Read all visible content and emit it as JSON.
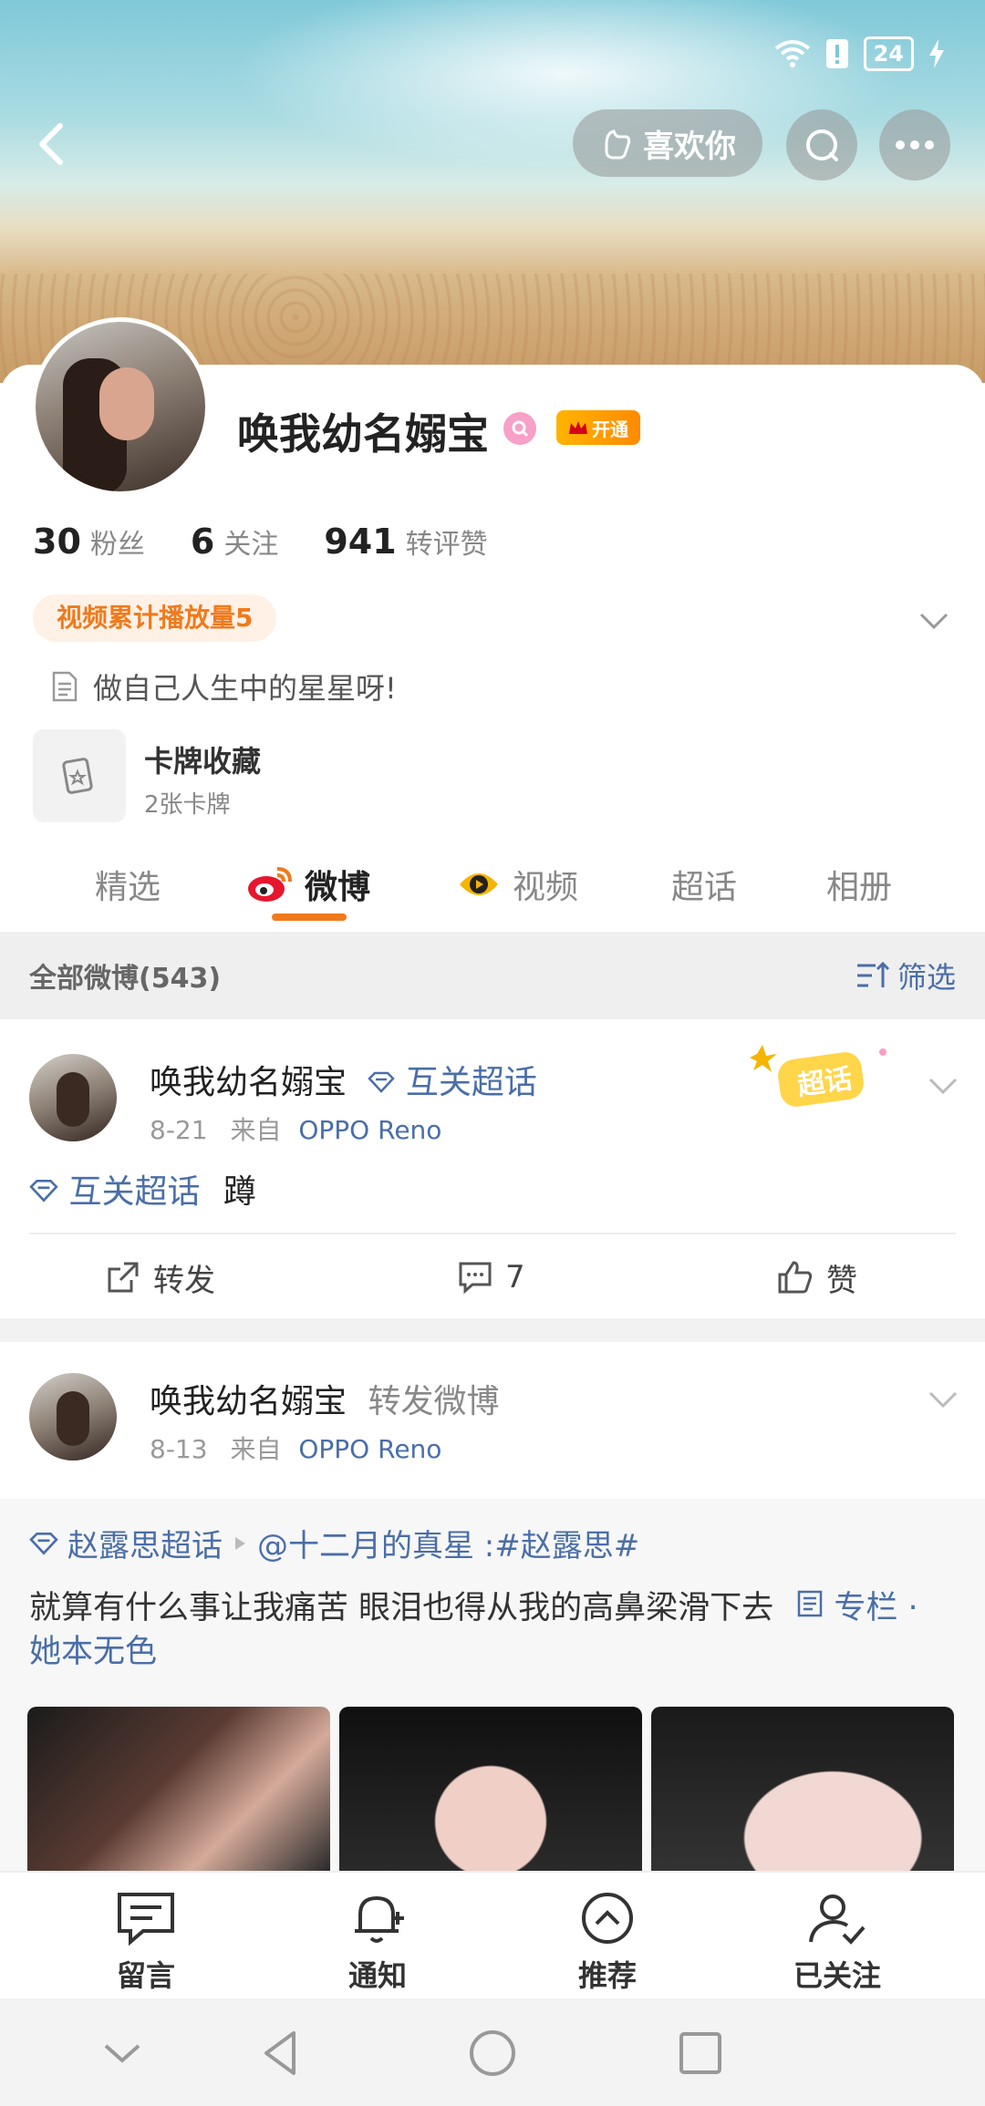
{
  "status_bar": {
    "battery": "24"
  },
  "header": {
    "like_button_label": "喜欢你"
  },
  "profile": {
    "name": "唤我幼名嫋宝",
    "vip_label": "开通",
    "stats": [
      {
        "value": "30",
        "label": "粉丝"
      },
      {
        "value": "6",
        "label": "关注"
      },
      {
        "value": "941",
        "label": "转评赞"
      }
    ],
    "tag": "视频累计播放量5",
    "bio": "做自己人生中的星星呀!",
    "card_collection": {
      "title": "卡牌收藏",
      "subtitle": "2张卡牌"
    }
  },
  "tabs": [
    {
      "label": "精选"
    },
    {
      "label": "微博"
    },
    {
      "label": "视频"
    },
    {
      "label": "超话"
    },
    {
      "label": "相册"
    }
  ],
  "filter_bar": {
    "count_label": "全部微博(543)",
    "filter_label": "筛选"
  },
  "posts": [
    {
      "author": "唤我幼名嫋宝",
      "topic_label": "互关超话",
      "sticker_label": "超话",
      "date": "8-21",
      "source_prefix": "来自",
      "device": "OPPO Reno",
      "link": "互关超话",
      "text": "蹲",
      "actions": {
        "repost": "转发",
        "comments": "7",
        "like": "赞"
      }
    },
    {
      "author": "唤我幼名嫋宝",
      "action_label": "转发微博",
      "date": "8-13",
      "source_prefix": "来自",
      "device": "OPPO Reno",
      "repost": {
        "topic": "赵露思超话",
        "mention": "@十二月的真星 :#赵露思#",
        "text": "就算有什么事让我痛苦 眼泪也得从我的高鼻梁滑下去",
        "column_link": "专栏 · 她本无色"
      }
    }
  ],
  "bottom_bar": [
    {
      "label": "留言",
      "icon": "message-icon"
    },
    {
      "label": "通知",
      "icon": "bell-add-icon"
    },
    {
      "label": "推荐",
      "icon": "up-circle-icon"
    },
    {
      "label": "已关注",
      "icon": "user-check-icon"
    }
  ]
}
